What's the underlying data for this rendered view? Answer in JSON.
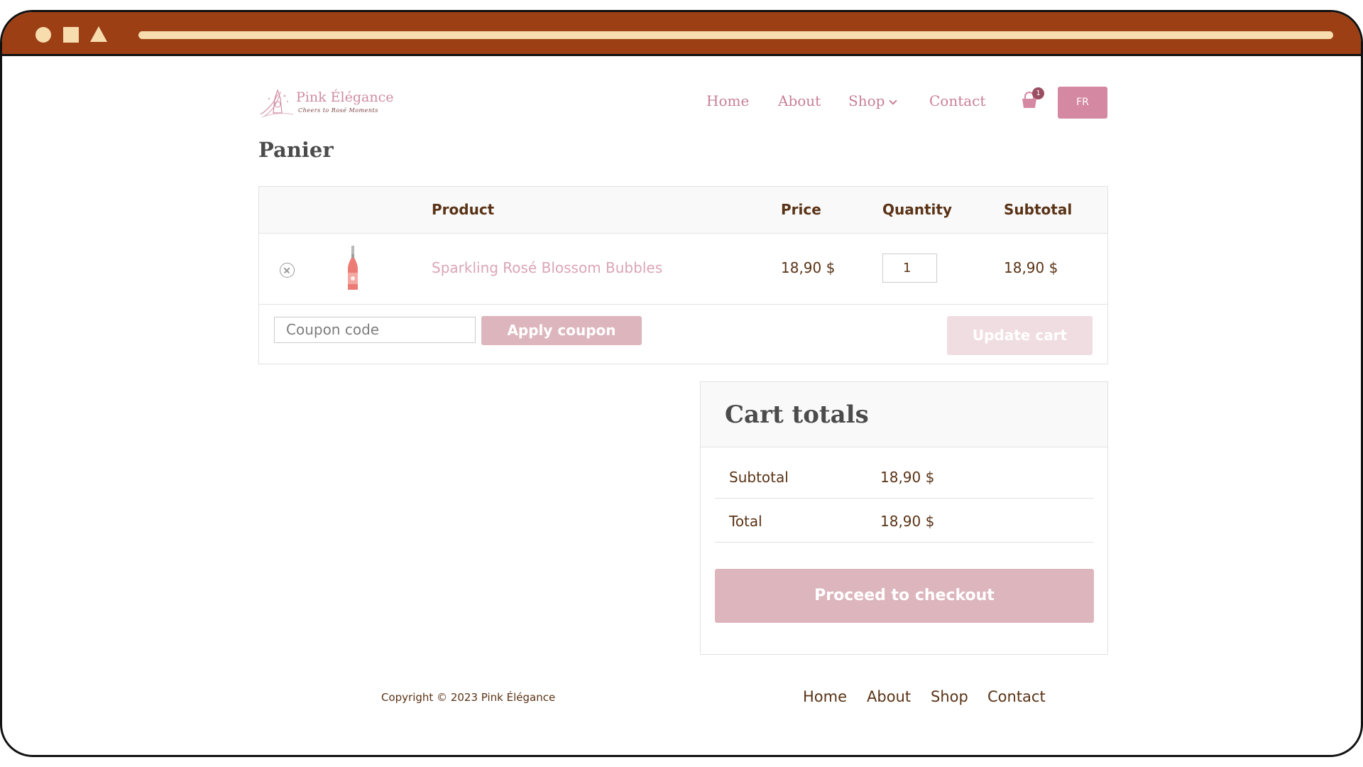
{
  "header": {
    "logo_title": "Pink Élégance",
    "logo_tagline": "Cheers to Rosé Moments",
    "nav": [
      "Home",
      "About",
      "Shop",
      "Contact"
    ],
    "cart_count": "1",
    "language": "FR"
  },
  "page_title": "Panier",
  "cart_table": {
    "columns": [
      "Product",
      "Price",
      "Quantity",
      "Subtotal"
    ],
    "row": {
      "product": "Sparkling Rosé Blossom Bubbles",
      "price": "18,90 $",
      "quantity": "1",
      "subtotal": "18,90 $"
    },
    "coupon_placeholder": "Coupon code",
    "apply_coupon": "Apply coupon",
    "update_cart": "Update cart"
  },
  "cart_totals": {
    "title": "Cart totals",
    "subtotal_label": "Subtotal",
    "subtotal_value": "18,90 $",
    "total_label": "Total",
    "total_value": "18,90 $",
    "checkout": "Proceed to checkout"
  },
  "footer": {
    "copyright": "Copyright © 2023 Pink Élégance",
    "links": [
      "Home",
      "About",
      "Shop",
      "Contact"
    ]
  },
  "colors": {
    "browser_bar": "#9c3f15",
    "browser_controls": "#f7dcae",
    "accent_pink": "#d488a1",
    "button_pink": "#ddb5bd",
    "text_brown": "#5a3316"
  },
  "icons": [
    "logo-mark",
    "cart-icon",
    "remove-icon",
    "chevron-down-icon"
  ]
}
